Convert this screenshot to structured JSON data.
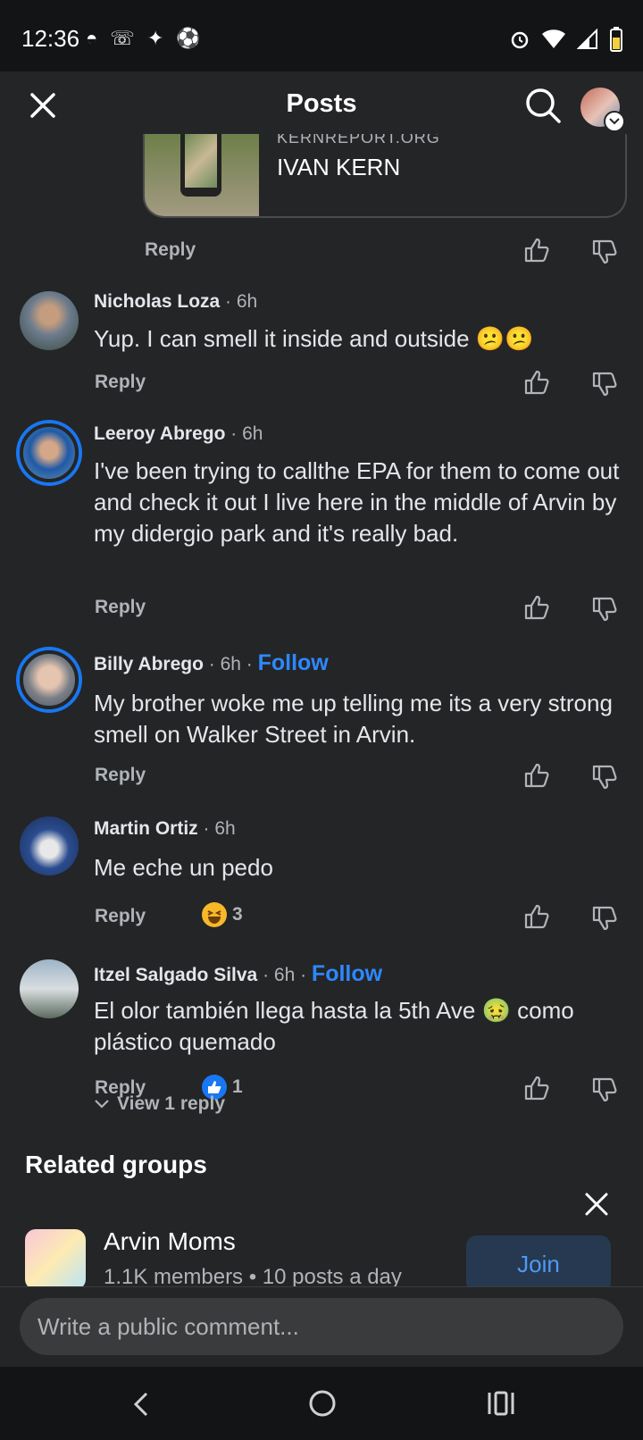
{
  "status_bar": {
    "time": "12:36"
  },
  "header": {
    "title": "Posts"
  },
  "link_preview": {
    "domain": "KERNREPORT.ORG",
    "headline": "IVAN KERN",
    "reply_label": "Reply"
  },
  "comments": [
    {
      "name": "Nicholas Loza",
      "meta": " · 6h",
      "text": "Yup. I can smell it inside and outside 😕😕",
      "reply_label": "Reply"
    },
    {
      "name": "Leeroy Abrego",
      "meta": " · 6h",
      "text": "I've been trying to callthe EPA for them to come out and check it out I live here in the middle of Arvin by my didergio park and it's really bad.",
      "reply_label": "Reply"
    },
    {
      "name": "Billy Abrego",
      "meta": " · 6h · ",
      "follow": "Follow",
      "text": "My brother woke me up telling me its a very strong smell on Walker Street in Arvin.",
      "reply_label": "Reply"
    },
    {
      "name": "Martin Ortiz",
      "meta": " · 6h",
      "text": "Me eche un pedo",
      "reply_label": "Reply",
      "reaction_count": "3"
    },
    {
      "name": "Itzel Salgado Silva",
      "meta": " · 6h · ",
      "follow": "Follow",
      "text": "El olor también llega hasta la 5th Ave 🤢 como plástico quemado",
      "reply_label": "Reply",
      "reaction_count": "1"
    }
  ],
  "view_replies": "View 1 reply",
  "related": {
    "title": "Related groups",
    "group": {
      "name": "Arvin Moms",
      "meta": "1.1K members • 10 posts a day",
      "join_label": "Join"
    }
  },
  "composer": {
    "placeholder": "Write a public comment..."
  }
}
